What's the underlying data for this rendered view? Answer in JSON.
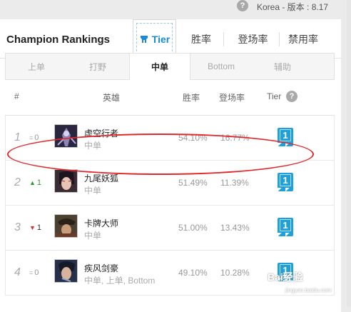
{
  "topbar": {
    "help_icon": "?",
    "version": "Korea - 版本 : 8.17"
  },
  "header": {
    "title": "Champion Rankings",
    "tabs": [
      {
        "label": "Tier",
        "icon": "tier-icon",
        "active": true
      },
      {
        "label": "胜率",
        "active": false
      },
      {
        "label": "登场率",
        "active": false
      },
      {
        "label": "禁用率",
        "active": false
      }
    ]
  },
  "positions": [
    {
      "label": "上单",
      "active": false
    },
    {
      "label": "打野",
      "active": false
    },
    {
      "label": "中单",
      "active": true
    },
    {
      "label": "Bottom",
      "active": false
    },
    {
      "label": "辅助",
      "active": false
    }
  ],
  "columns": {
    "rank": "#",
    "champion": "英雄",
    "winrate": "胜率",
    "pickrate": "登场率",
    "tier": "Tier",
    "tier_help": "?"
  },
  "rows": [
    {
      "rank": "1",
      "arrow": "=",
      "change": "0",
      "trend": "same",
      "name": "虚空行者",
      "position": "中单",
      "winrate": "54.10%",
      "pickrate": "16.77%",
      "tier": "1",
      "avatar_color": "#3a3550"
    },
    {
      "rank": "2",
      "arrow": "▲",
      "change": "1",
      "trend": "up",
      "name": "九尾妖狐",
      "position": "中单",
      "winrate": "51.49%",
      "pickrate": "11.39%",
      "tier": "1",
      "avatar_color": "#4a3a3a"
    },
    {
      "rank": "3",
      "arrow": "▼",
      "change": "1",
      "trend": "down",
      "name": "卡牌大师",
      "position": "中单",
      "winrate": "51.00%",
      "pickrate": "13.43%",
      "tier": "1",
      "avatar_color": "#6b5a3a"
    },
    {
      "rank": "4",
      "arrow": "=",
      "change": "0",
      "trend": "same",
      "name": "疾风剑豪",
      "position": "中单, 上单, Bottom",
      "winrate": "49.10%",
      "pickrate": "10.28%",
      "tier": "1",
      "avatar_color": "#2d3a55"
    }
  ],
  "colors": {
    "accent": "#1a8bd6",
    "badge": "#1ea0dc",
    "highlight": "#e0282b",
    "up": "#2d9c2d",
    "down": "#d93030"
  },
  "watermark": {
    "text": "Bai经验",
    "sub": "jingyan.baidu.com"
  }
}
